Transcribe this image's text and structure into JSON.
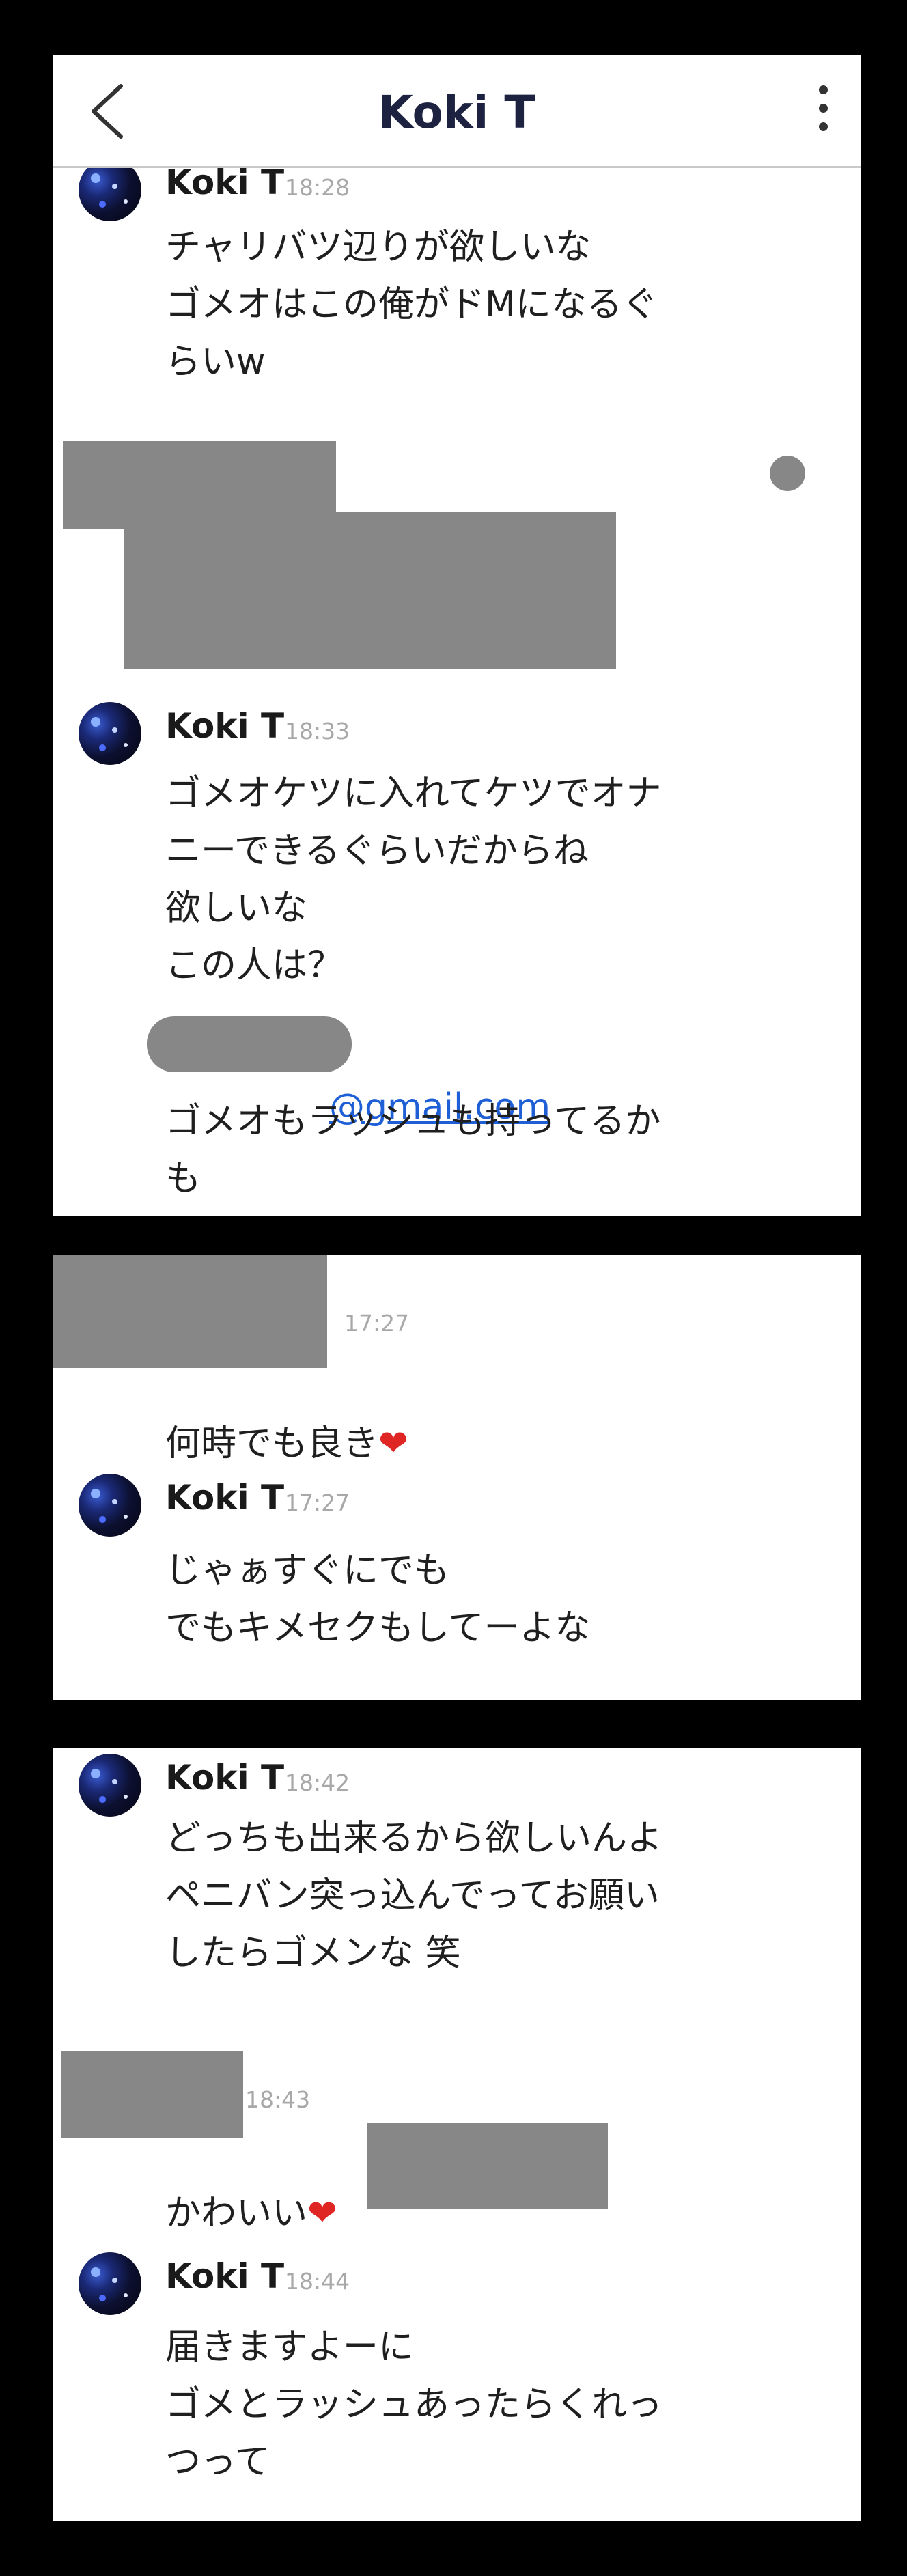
{
  "header": {
    "title": "Koki T"
  },
  "panel1": {
    "messages": [
      {
        "sender": "Koki T",
        "time": "18:28",
        "text": "チャリバツ辺りが欲しいな\nゴメオはこの俺がドMになるぐ\nらいw"
      },
      {
        "sender": "Koki T",
        "time": "18:33",
        "text": "ゴメオケツに入れてケツでオナ\nニーできるぐらいだからね\n欲しいな\nこの人は？"
      }
    ],
    "email_suffix": "@gmail.com",
    "after_email": "ゴメオもラッシュも持ってるか\nも"
  },
  "panel2": {
    "self_time": "17:27",
    "self_text": "何時でも良き",
    "heart": "❤",
    "reply": {
      "sender": "Koki T",
      "time": "17:27",
      "text": "じゃぁすぐにでも\nでもキメセクもしてーよな"
    }
  },
  "panel3": {
    "msg1": {
      "sender": "Koki T",
      "time": "18:42",
      "text": "どっちも出来るから欲しいんよ\nペニバン突っ込んでってお願い\nしたらゴメンな 笑"
    },
    "self_time": "18:43",
    "self_text": "かわいい",
    "heart": "❤",
    "msg2": {
      "sender": "Koki T",
      "time": "18:44",
      "text": "届きますよーに\nゴメとラッシュあったらくれっ\nつって"
    }
  }
}
